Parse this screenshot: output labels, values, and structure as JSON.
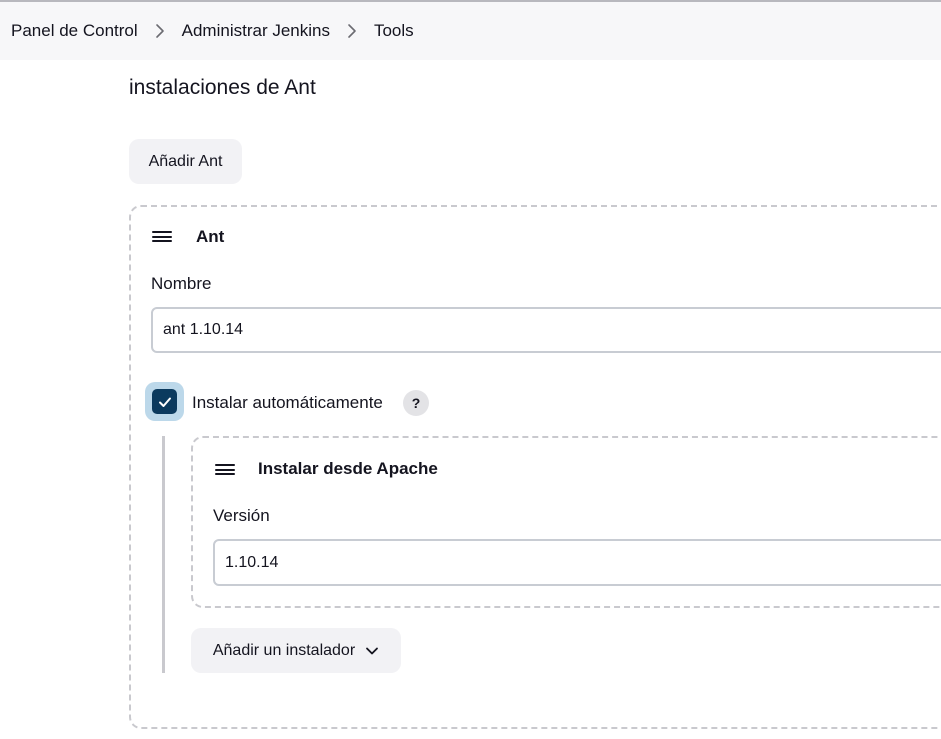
{
  "breadcrumb": {
    "items": [
      "Panel de Control",
      "Administrar Jenkins",
      "Tools"
    ]
  },
  "section": {
    "title": "instalaciones de Ant",
    "add_button": "Añadir Ant"
  },
  "ant_card": {
    "title": "Ant",
    "name_label": "Nombre",
    "name_value": "ant 1.10.14",
    "auto_install_label": "Instalar automáticamente",
    "auto_install_checked": true,
    "help_label": "?"
  },
  "installer_card": {
    "title": "Instalar desde Apache",
    "version_label": "Versión",
    "version_value": "1.10.14",
    "add_installer_button": "Añadir un instalador"
  },
  "colors": {
    "checkbox": "#0b3a5e",
    "checkbox_ring": "#bcd8ea",
    "button_bg": "#f2f2f5",
    "breadcrumb_bg": "#f7f7f9"
  },
  "icons": {
    "breadcrumb_separator": "chevron-right-icon",
    "drag_handle": "drag-handle-icon",
    "checkbox": "check-icon",
    "dropdown": "chevron-down-icon"
  }
}
